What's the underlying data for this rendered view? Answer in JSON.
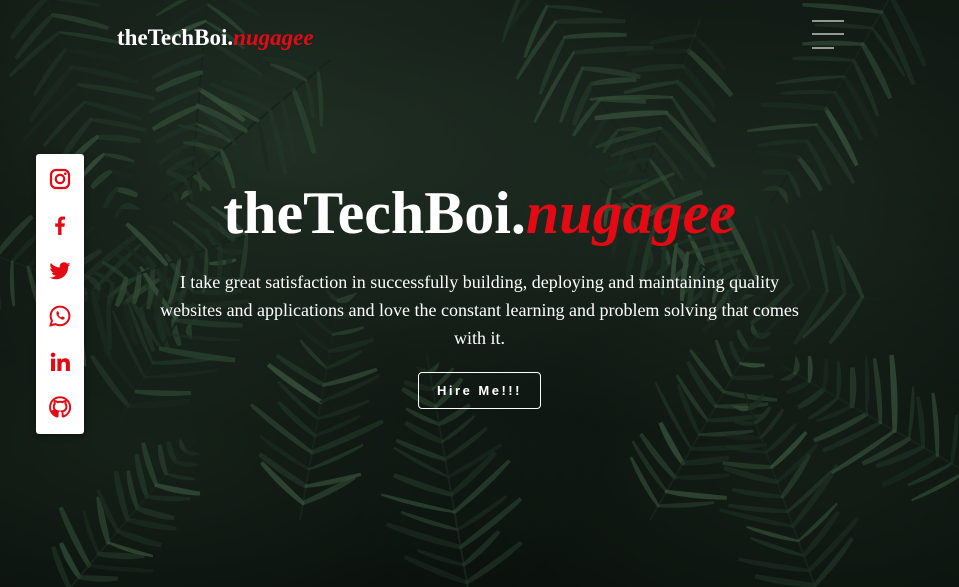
{
  "navbar": {
    "brand_main": "theTechBoi.",
    "brand_accent": "nugagee",
    "menu_icon": "hamburger-menu-icon"
  },
  "social": {
    "items": [
      {
        "name": "Instagram",
        "icon": "instagram-icon"
      },
      {
        "name": "Facebook",
        "icon": "facebook-icon"
      },
      {
        "name": "Twitter",
        "icon": "twitter-icon"
      },
      {
        "name": "WhatsApp",
        "icon": "whatsapp-icon"
      },
      {
        "name": "LinkedIn",
        "icon": "linkedin-icon"
      },
      {
        "name": "GitHub",
        "icon": "github-icon"
      }
    ]
  },
  "hero": {
    "title_main": "theTechBoi.",
    "title_accent": "nugagee",
    "description": "I take great satisfaction in successfully building, deploying and maintaining quality websites and applications and love the constant learning and problem solving that comes with it.",
    "cta_label": "Hire Me!!!",
    "background": "palm-leaves-photo"
  },
  "colors": {
    "accent": "#e50914",
    "text": "#ffffff",
    "social_bar_bg": "#ffffff"
  }
}
